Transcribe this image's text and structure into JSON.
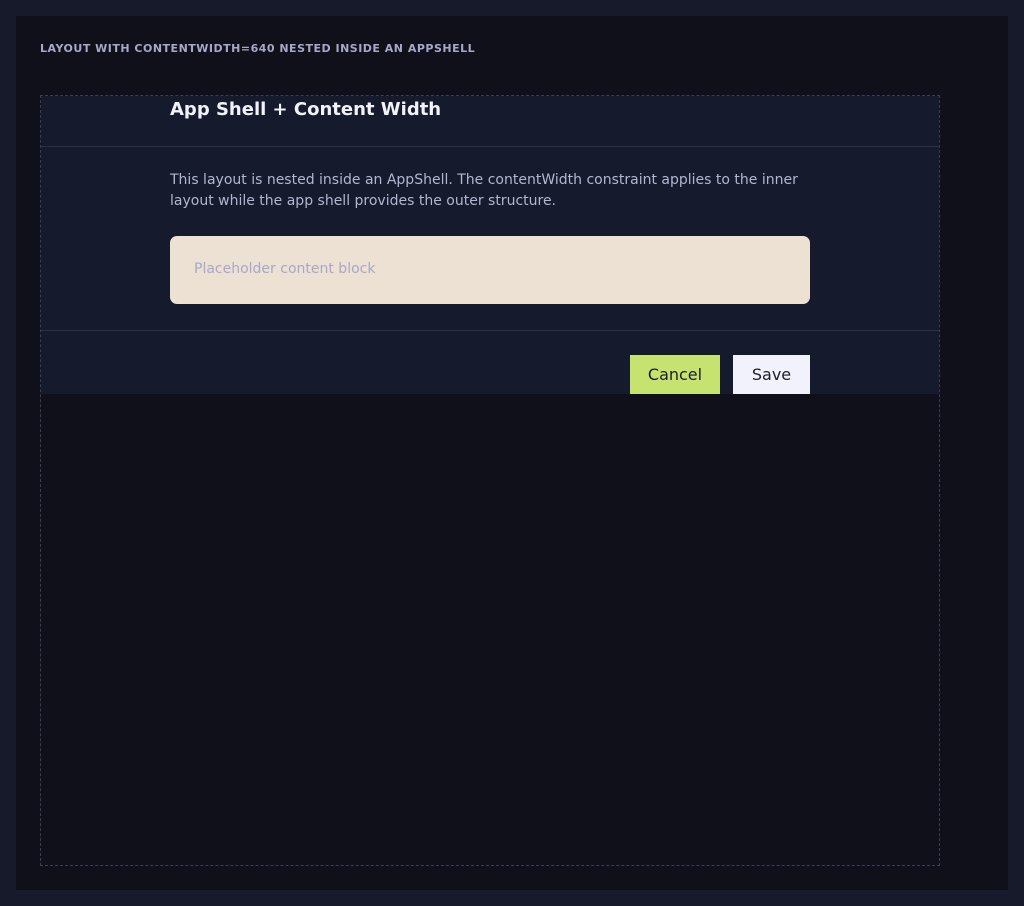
{
  "caption": "LAYOUT WITH CONTENTWIDTH=640 NESTED INSIDE AN APPSHELL",
  "layout": {
    "title": "App Shell + Content Width",
    "description": "This layout is nested inside an AppShell. The contentWidth constraint applies to the inner layout while the app shell provides the outer structure.",
    "placeholder": "Placeholder content block"
  },
  "footer": {
    "cancel_label": "Cancel",
    "save_label": "Save"
  },
  "colors": {
    "page_background": "#171a2b",
    "stage_background": "#10101b",
    "layout_background": "#161a2d",
    "placeholder_background": "#ede1d4",
    "cancel_button": "#c6e36f",
    "save_button": "#f1f2fb"
  }
}
